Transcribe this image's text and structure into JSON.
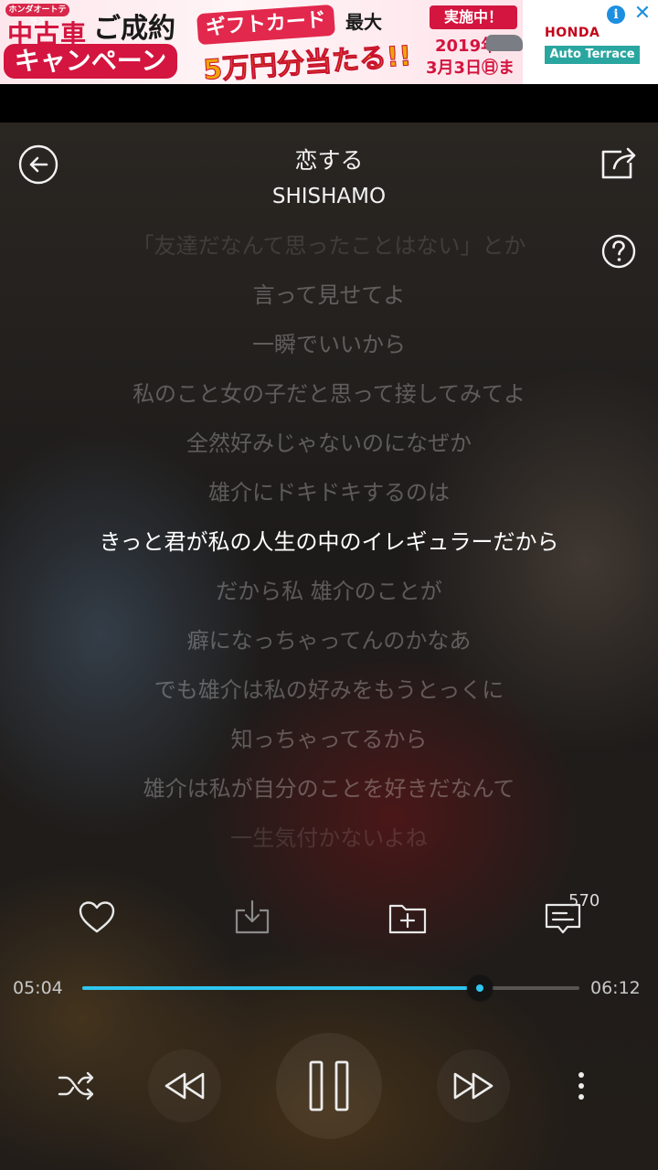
{
  "ad": {
    "brand_tag": "ホンダオートテラス",
    "used_car": "中古車",
    "seiyaku": "ご成約",
    "campaign": "キャンペーン",
    "gift_card": "ギフトカード",
    "amount": "5万円分当たる!!",
    "max": "最大",
    "now_running": "実施中！",
    "date_year": "2019年",
    "date_until": "3月3日㊐まで",
    "honda": "HONDA",
    "auto_terrace": "Auto Terrace",
    "info_icon": "info-icon",
    "close_icon": "close-icon"
  },
  "player": {
    "title": "恋する",
    "artist": "SHISHAMO",
    "lyrics": [
      "「友達だなんて思ったことはない」とか",
      "言って見せてよ",
      "一瞬でいいから",
      "私のこと女の子だと思って接してみてよ",
      "全然好みじゃないのになぜか",
      "雄介にドキドキするのは",
      "きっと君が私の人生の中のイレギュラーだから",
      "だから私 雄介のことが",
      "癖になっちゃってんのかなあ",
      "でも雄介は私の好みをもうとっくに",
      "知っちゃってるから",
      "雄介は私が自分のことを好きだなんて",
      "一生気付かないよね"
    ],
    "current_line_index": 6,
    "comment_count": "570",
    "time_current": "05:04",
    "time_total": "06:12",
    "progress_fraction": 0.8,
    "accent_color": "#2fc6ef",
    "icons": {
      "back": "back-arrow-icon",
      "share": "share-icon",
      "help": "help-icon",
      "like": "heart-icon",
      "download": "download-icon",
      "add_to_playlist": "add-folder-icon",
      "comments": "comment-icon",
      "shuffle": "shuffle-icon",
      "previous": "rewind-icon",
      "pause": "pause-icon",
      "next": "fast-forward-icon",
      "more": "more-vertical-icon"
    }
  }
}
